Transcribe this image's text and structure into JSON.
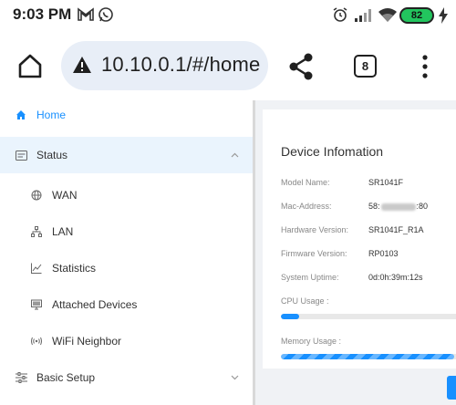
{
  "status_bar": {
    "time": "9:03 PM",
    "battery": "82",
    "icons": [
      "gmail-icon",
      "whatsapp-icon",
      "alarm-icon",
      "signal-icon",
      "wifi-icon",
      "battery-icon",
      "charging-icon"
    ]
  },
  "browser": {
    "url": "10.10.0.1/#/home",
    "tab_count": "8",
    "icons": [
      "home-icon",
      "warning-icon",
      "share-icon",
      "tabs-icon",
      "more-icon"
    ]
  },
  "sidebar": {
    "items": [
      {
        "label": "Home",
        "icon": "home-icon"
      },
      {
        "label": "Status",
        "icon": "status-icon"
      },
      {
        "label": "WAN",
        "icon": "globe-icon"
      },
      {
        "label": "LAN",
        "icon": "network-icon"
      },
      {
        "label": "Statistics",
        "icon": "chart-icon"
      },
      {
        "label": "Attached Devices",
        "icon": "monitor-icon"
      },
      {
        "label": "WiFi Neighbor",
        "icon": "wifi-signal-icon"
      },
      {
        "label": "Basic Setup",
        "icon": "sliders-icon"
      }
    ]
  },
  "device_info": {
    "title": "Device Infomation",
    "rows": [
      {
        "label": "Model Name:",
        "value": "SR1041F"
      },
      {
        "label": "Mac-Address:",
        "value_prefix": "58:",
        "value_suffix": ":80"
      },
      {
        "label": "Hardware Version:",
        "value": "SR1041F_R1A"
      },
      {
        "label": "Firmware Version:",
        "value": "RP0103"
      },
      {
        "label": "System Uptime:",
        "value": "0d:0h:39m:12s"
      }
    ],
    "cpu_label": "CPU Usage :",
    "cpu_usage_fraction": 0.1,
    "memory_label": "Memory Usage :",
    "memory_usage_fraction": 0.95
  },
  "colors": {
    "accent": "#1890ff",
    "active_bg": "#eaf4fd",
    "battery": "#22c55e"
  }
}
